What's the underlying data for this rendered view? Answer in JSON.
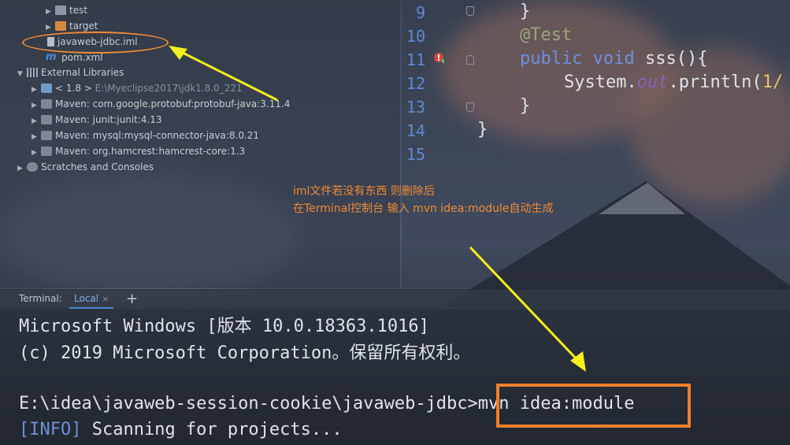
{
  "project_tree": [
    {
      "label": "test",
      "kind": "folder",
      "indent": 1
    },
    {
      "label": "target",
      "kind": "folder-target",
      "indent": 1
    },
    {
      "label": "javaweb-jdbc.iml",
      "kind": "file",
      "indent": 1
    },
    {
      "label": "pom.xml",
      "kind": "pom",
      "indent": 1
    },
    {
      "label": "External Libraries",
      "kind": "libraries",
      "indent": 0
    },
    {
      "label": "< 1.8 >",
      "extra": "E:\\Myeclipse2017\\jdk1.8.0_221",
      "kind": "jdk",
      "indent": 1
    },
    {
      "label": "Maven: com.google.protobuf:protobuf-java:3.11.4",
      "kind": "jar",
      "indent": 1
    },
    {
      "label": "Maven: junit:junit:4.13",
      "kind": "jar",
      "indent": 1
    },
    {
      "label": "Maven: mysql:mysql-connector-java:8.0.21",
      "kind": "jar",
      "indent": 1
    },
    {
      "label": "Maven: org.hamcrest:hamcrest-core:1.3",
      "kind": "jar",
      "indent": 1
    },
    {
      "label": "Scratches and Consoles",
      "kind": "scratch",
      "indent": 0
    }
  ],
  "editor": {
    "line_numbers": [
      "9",
      "10",
      "11",
      "12",
      "13",
      "14",
      "15"
    ],
    "code": {
      "l9": "}",
      "l10_annotation": "@Test",
      "l11_kw1": "public",
      "l11_kw2": "void",
      "l11_rest": "sss(){",
      "l12_pre": "System.",
      "l12_field": "out",
      "l12_post": ".println(",
      "l12_tail": "1/",
      "l13": "}",
      "l14": "}"
    }
  },
  "annotation": {
    "line1": "iml文件若没有东西 则删除后",
    "line2": "在Terminal控制台 输入 mvn idea:module自动生成"
  },
  "terminal": {
    "title": "Terminal:",
    "tab_local": "Local",
    "tab_close": "×",
    "tab_add": "+",
    "lines": {
      "l1": "Microsoft Windows [版本 10.0.18363.1016]",
      "l2": "(c) 2019 Microsoft Corporation。保留所有权利。",
      "prompt": "E:\\idea\\javaweb-session-cookie\\javaweb-jdbc>",
      "command": "mvn idea:module",
      "info_tag": "[INFO]",
      "info_text": " Scanning for projects..."
    }
  },
  "colors": {
    "highlight": "#ef8a35",
    "arrow": "#f5ef1a",
    "keyword": "#6f8fdc",
    "line_number": "#5d8bd0"
  }
}
